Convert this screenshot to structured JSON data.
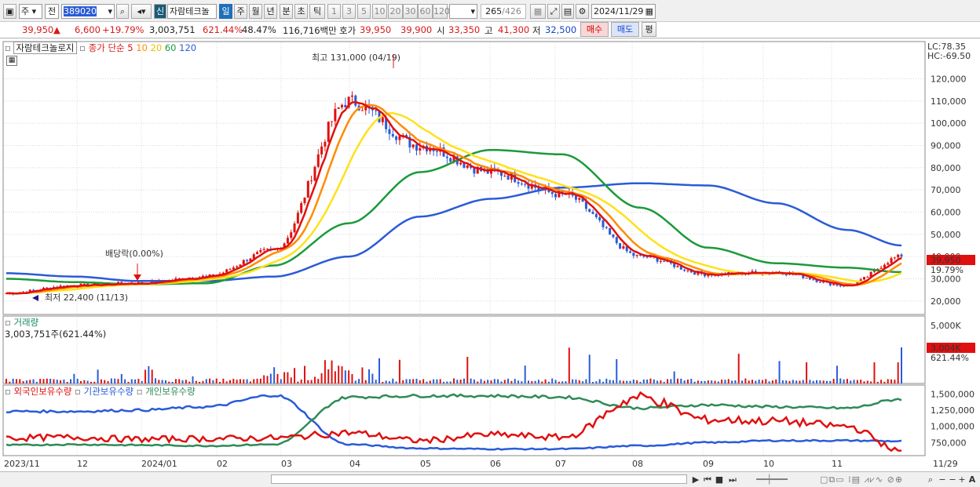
{
  "toolbar": {
    "market": "주",
    "prev": "전",
    "code": "389020",
    "badge": "신",
    "name": "자람테크놀",
    "periods": [
      "일",
      "주",
      "월",
      "년",
      "분",
      "초",
      "틱"
    ],
    "active_period": "일",
    "intervals": [
      "1",
      "3",
      "5",
      "10",
      "20",
      "30",
      "60",
      "120"
    ],
    "count": "265",
    "total": "/426",
    "date": "2024/11/29"
  },
  "quote": {
    "price": "39,950",
    "change": "6,600",
    "change_pct": "+19.79%",
    "volume": "3,003,751",
    "volume_ratio": "621.44%",
    "turnover_pct": "48.47%",
    "amount": "116,716백만",
    "ask_label": "호가",
    "ask": "39,950",
    "bid": "39,900",
    "open_label": "시",
    "open": "33,350",
    "high_label": "고",
    "high": "41,300",
    "low_label": "저",
    "low": "32,500",
    "buy_label": "매수",
    "sell_label": "매도",
    "eval_label": "평"
  },
  "legend": {
    "stock_name": "자람테크놀로지",
    "ma_label": "종가 단순",
    "ma_periods": [
      "5",
      "10",
      "20",
      "60",
      "120"
    ],
    "ma_colors": [
      "#e01010",
      "#ff8c00",
      "#ffe11a",
      "#1a9a3a",
      "#2a5bd8"
    ]
  },
  "price_panel": {
    "lc": "LC:78.35",
    "hc": "HC:-69.50",
    "high_note": "최고 131,000 (04/19)",
    "low_note": "최저 22,400 (11/13)",
    "dividend_note": "배당락(0.00%)",
    "current_price": "39,950",
    "current_pct": "19.79%",
    "y_ticks": [
      "120,000",
      "110,000",
      "100,000",
      "90,000",
      "80,000",
      "70,000",
      "60,000",
      "50,000",
      "40,000",
      "30,000",
      "20,000"
    ]
  },
  "volume_panel": {
    "title": "거래량",
    "value": "3,003,751주(621.44%)",
    "y_tick": "5,000K",
    "current": "3,004K",
    "current_pct": "621.44%"
  },
  "holding_panel": {
    "labels": [
      "외국인보유수량",
      "기관보유수량",
      "개인보유수량"
    ],
    "colors": [
      "#e01010",
      "#2a5bd8",
      "#2e8b57"
    ],
    "y_ticks": [
      "1,500,000",
      "1,250,000",
      "1,000,000",
      "750,000"
    ]
  },
  "x_axis": [
    "2023/11",
    "12",
    "2024/01",
    "02",
    "03",
    "04",
    "05",
    "06",
    "07",
    "08",
    "09",
    "10",
    "11",
    "11/29"
  ],
  "chart_data": {
    "type": "line",
    "x": [
      "2023/11",
      "12",
      "2024/01",
      "02",
      "03",
      "04",
      "05",
      "06",
      "07",
      "08",
      "09",
      "10",
      "11",
      "11/29"
    ],
    "series": [
      {
        "name": "종가",
        "values": [
          23500,
          27000,
          28000,
          31000,
          43000,
          110000,
          90000,
          78000,
          68000,
          40000,
          32000,
          33000,
          27000,
          39950
        ]
      },
      {
        "name": "60",
        "values": [
          30000,
          28500,
          27500,
          28000,
          36000,
          55000,
          78000,
          88000,
          86000,
          62000,
          44000,
          37000,
          35000,
          33000
        ]
      },
      {
        "name": "120",
        "values": [
          32500,
          31000,
          29000,
          29000,
          31000,
          40000,
          58000,
          66000,
          71000,
          73000,
          72000,
          64000,
          52000,
          45000
        ]
      },
      {
        "name": "외국인보유수량",
        "values": [
          820000,
          830000,
          800000,
          810000,
          820000,
          900000,
          780000,
          870000,
          830000,
          1450000,
          1100000,
          1080000,
          1000000,
          620000
        ]
      },
      {
        "name": "기관보유수량",
        "values": [
          1230000,
          1230000,
          1250000,
          1300000,
          1480000,
          720000,
          660000,
          650000,
          650000,
          700000,
          750000,
          780000,
          780000,
          770000
        ]
      },
      {
        "name": "개인보유수량",
        "values": [
          710000,
          720000,
          710000,
          700000,
          720000,
          1450000,
          1470000,
          1470000,
          1450000,
          1280000,
          1330000,
          1300000,
          1280000,
          1420000
        ]
      }
    ],
    "ylim": [
      15000,
      135000
    ]
  }
}
